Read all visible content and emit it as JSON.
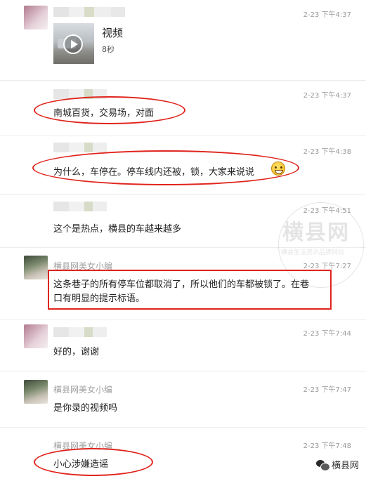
{
  "messages": [
    {
      "time": "2-23 下午4:37",
      "video": {
        "label": "视频",
        "duration": "8秒",
        "play_icon": "play-icon"
      }
    },
    {
      "time": "2-23 下午4:37",
      "text": "南城百货，交易场，对面"
    },
    {
      "time": "2-23 下午4:38",
      "text": "为什么，车停在。停车线内还被，锁，大家来说说",
      "emoji": "grinning-emoji-icon"
    },
    {
      "time": "2-23 下午4:51",
      "text": "这个是热点，横县的车越来越多"
    },
    {
      "time": "2-23 下午7:27",
      "nickname": "横县网美女小编",
      "text_line1": "这条巷子的所有停车位都取消了，所以他们的车都被锁了。在巷",
      "text_line2": "口有明显的提示标语。"
    },
    {
      "time": "2-23 下午7:44",
      "text": "好的，谢谢"
    },
    {
      "time": "2-23 下午7:47",
      "nickname": "横县网美女小编",
      "text": "是你录的视频吗"
    },
    {
      "time": "2-23 下午7:48",
      "nickname": "横县网美女小编",
      "text": "小心涉嫌造谣"
    }
  ],
  "watermark": {
    "title": "横县网",
    "subtitle": "横县生活资讯品牌网站"
  },
  "brand": {
    "name": "横县网",
    "icon": "wechat-icon"
  },
  "colors": {
    "highlight": "#e0241c",
    "time": "#9a9a9a",
    "nickname": "#a0a0a0"
  }
}
